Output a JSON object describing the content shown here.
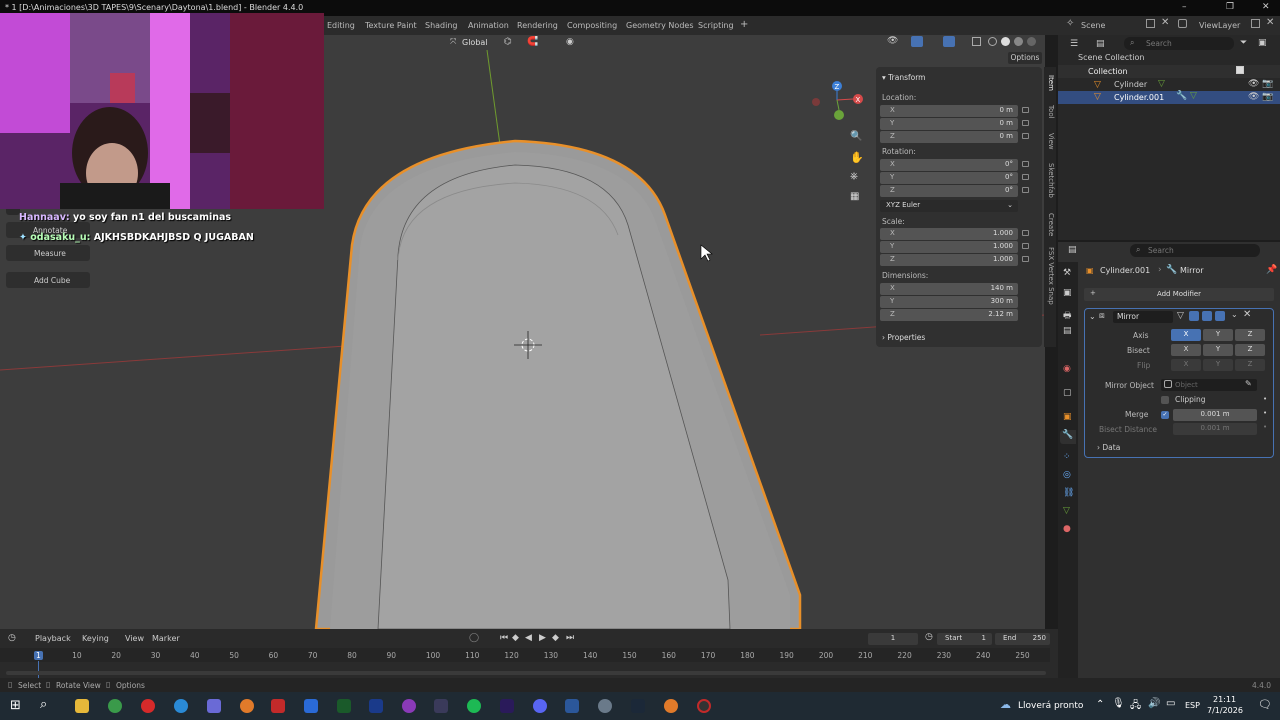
{
  "window": {
    "title": "* 1 [D:\\Animaciones\\3D TAPES\\9\\Scenary\\Daytona\\1.blend] - Blender 4.4.0",
    "minimize": "–",
    "maximize": "❐",
    "close": "✕"
  },
  "workspaces": [
    "Editing",
    "Texture Paint",
    "Shading",
    "Animation",
    "Rendering",
    "Compositing",
    "Geometry Nodes",
    "Scripting",
    "+"
  ],
  "header": {
    "transform_orientation": "Global",
    "options": "Options",
    "scene": "Scene",
    "view_layer": "ViewLayer",
    "outliner_search_placeholder": "Search"
  },
  "chat": [
    {
      "user": "Hannaav:",
      "message": "yo soy fan n1 del buscaminas"
    },
    {
      "user": "odasaku_u:",
      "message": "AJKHSBDKAHJBSD Q JUGABAN"
    }
  ],
  "tools": {
    "annotate": "Annotate",
    "measure": "Measure",
    "add_cube": "Add Cube"
  },
  "npanel": {
    "transform_title": "Transform",
    "location_label": "Location:",
    "location": [
      {
        "axis": "X",
        "value": "0 m"
      },
      {
        "axis": "Y",
        "value": "0 m"
      },
      {
        "axis": "Z",
        "value": "0 m"
      }
    ],
    "rotation_label": "Rotation:",
    "rotation": [
      {
        "axis": "X",
        "value": "0°"
      },
      {
        "axis": "Y",
        "value": "0°"
      },
      {
        "axis": "Z",
        "value": "0°"
      }
    ],
    "rotation_mode": "XYZ Euler",
    "scale_label": "Scale:",
    "scale": [
      {
        "axis": "X",
        "value": "1.000"
      },
      {
        "axis": "Y",
        "value": "1.000"
      },
      {
        "axis": "Z",
        "value": "1.000"
      }
    ],
    "dimensions_label": "Dimensions:",
    "dimensions": [
      {
        "axis": "X",
        "value": "140 m"
      },
      {
        "axis": "Y",
        "value": "300 m"
      },
      {
        "axis": "Z",
        "value": "2.12 m"
      }
    ],
    "properties_title": "Properties",
    "tabs": [
      "Item",
      "Tool",
      "View",
      "Sketchfab",
      "Create",
      "FSX Vertex Snap"
    ]
  },
  "outliner": {
    "scene_collection": "Scene Collection",
    "items": [
      "Collection",
      "Cylinder",
      "Cylinder.001"
    ]
  },
  "properties": {
    "search_placeholder": "Search",
    "object": "Cylinder.001",
    "modifier_crumb": "Mirror",
    "add_modifier": "Add Modifier",
    "modifier_name": "Mirror",
    "axis_label": "Axis",
    "bisect_label": "Bisect",
    "flip_label": "Flip",
    "x": "X",
    "y": "Y",
    "z": "Z",
    "mirror_object_label": "Mirror Object",
    "mirror_object_placeholder": "Object",
    "clipping": "Clipping",
    "merge": "Merge",
    "merge_value": "0.001 m",
    "bisect_distance": "Bisect Distance",
    "bisect_distance_value": "0.001 m",
    "data": "Data"
  },
  "timeline": {
    "playback": "Playback",
    "keying": "Keying",
    "view": "View",
    "marker": "Marker",
    "current_frame": "1",
    "start_label": "Start",
    "start": "1",
    "end_label": "End",
    "end": "250",
    "ruler": [
      "1",
      "10",
      "20",
      "30",
      "40",
      "50",
      "60",
      "70",
      "80",
      "90",
      "100",
      "110",
      "120",
      "130",
      "140",
      "150",
      "160",
      "170",
      "180",
      "190",
      "200",
      "210",
      "220",
      "230",
      "240",
      "250"
    ]
  },
  "status": {
    "select": "Select",
    "rotate_view": "Rotate View",
    "options": "Options",
    "version": "4.4.0"
  },
  "taskbar": {
    "weather": "Lloverá pronto",
    "lang": "ESP",
    "time": "21:11",
    "date": "7/1/2026"
  },
  "colors": {
    "selection_outline": "#e8902a",
    "active_blue": "#4772b3",
    "viewport_bg": "#3d3d3d"
  }
}
